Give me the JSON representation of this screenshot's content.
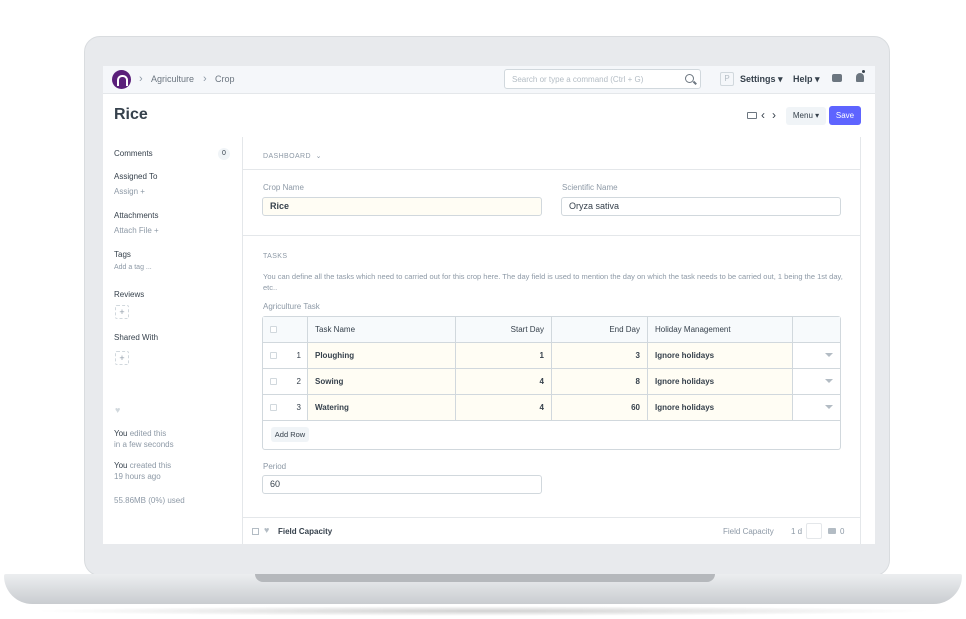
{
  "navbar": {
    "breadcrumbs": [
      "Agriculture",
      "Crop"
    ],
    "search_placeholder": "Search or type a command (Ctrl + G)",
    "p_badge": "P",
    "settings_label": "Settings ▾",
    "help_label": "Help ▾"
  },
  "page": {
    "title": "Rice",
    "prev_glyph": "‹",
    "next_glyph": "›",
    "menu_label": "Menu ▾",
    "save_label": "Save"
  },
  "sidebar": {
    "comments_label": "Comments",
    "comments_count": "0",
    "assigned_to_label": "Assigned To",
    "assign_link": "Assign +",
    "attachments_label": "Attachments",
    "attach_link": "Attach File +",
    "tags_label": "Tags",
    "add_tag_link": "Add a tag ...",
    "reviews_label": "Reviews",
    "shared_with_label": "Shared With",
    "plus": "+",
    "edited_user": "You",
    "edited_text": "edited this",
    "edited_time": "in a few seconds",
    "created_user": "You",
    "created_text": "created this",
    "created_time": "19 hours ago",
    "usage": "55.86MB (0%) used"
  },
  "form": {
    "dashboard_label": "DASHBOARD",
    "crop_name_label": "Crop Name",
    "crop_name_value": "Rice",
    "scientific_name_label": "Scientific Name",
    "scientific_name_value": "Oryza sativa",
    "tasks_section_label": "TASKS",
    "tasks_description": "You can define all the tasks which need to carried out for this crop here. The day field is used to mention the day on which the task needs to be carried out, 1 being the 1st day, etc..",
    "agriculture_task_label": "Agriculture Task",
    "grid_headers": {
      "task_name": "Task Name",
      "start_day": "Start Day",
      "end_day": "End Day",
      "holiday": "Holiday Management"
    },
    "rows": [
      {
        "idx": "1",
        "task": "Ploughing",
        "start": "1",
        "end": "3",
        "holiday": "Ignore holidays"
      },
      {
        "idx": "2",
        "task": "Sowing",
        "start": "4",
        "end": "8",
        "holiday": "Ignore holidays"
      },
      {
        "idx": "3",
        "task": "Watering",
        "start": "4",
        "end": "60",
        "holiday": "Ignore holidays"
      }
    ],
    "add_row_label": "Add Row",
    "period_label": "Period",
    "period_value": "60"
  },
  "bottom_bar": {
    "title": "Field Capacity",
    "right_label": "Field Capacity",
    "duration": "1 d",
    "comment_count": "0"
  }
}
